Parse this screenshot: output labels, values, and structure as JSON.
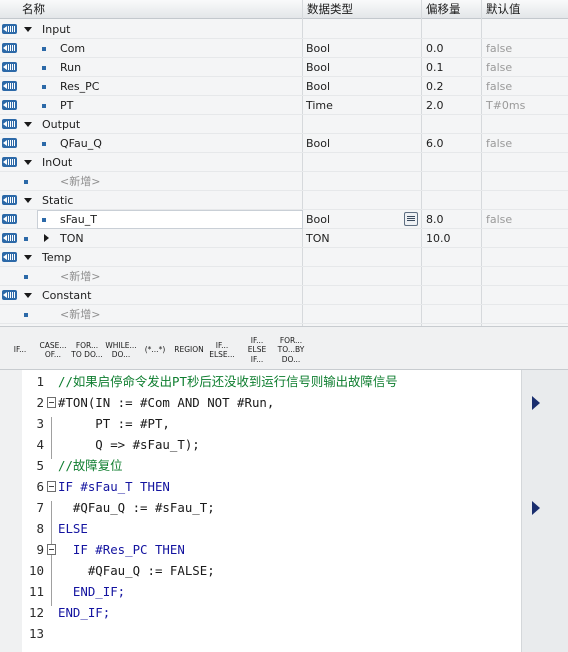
{
  "header": {
    "name": "名称",
    "datatype": "数据类型",
    "offset": "偏移量",
    "default": "默认值"
  },
  "rows": [
    {
      "name": "Input",
      "type": "",
      "offset": "",
      "default": ""
    },
    {
      "name": "Com",
      "type": "Bool",
      "offset": "0.0",
      "default": "false"
    },
    {
      "name": "Run",
      "type": "Bool",
      "offset": "0.1",
      "default": "false"
    },
    {
      "name": "Res_PC",
      "type": "Bool",
      "offset": "0.2",
      "default": "false"
    },
    {
      "name": "PT",
      "type": "Time",
      "offset": "2.0",
      "default": "T#0ms"
    },
    {
      "name": "Output",
      "type": "",
      "offset": "",
      "default": ""
    },
    {
      "name": "QFau_Q",
      "type": "Bool",
      "offset": "6.0",
      "default": "false"
    },
    {
      "name": "InOut",
      "type": "",
      "offset": "",
      "default": ""
    },
    {
      "name": "<新增>",
      "type": "",
      "offset": "",
      "default": ""
    },
    {
      "name": "Static",
      "type": "",
      "offset": "",
      "default": ""
    },
    {
      "name": "sFau_T",
      "type": "Bool",
      "offset": "8.0",
      "default": "false"
    },
    {
      "name": "TON",
      "type": "TON",
      "offset": "10.0",
      "default": ""
    },
    {
      "name": "Temp",
      "type": "",
      "offset": "",
      "default": ""
    },
    {
      "name": "<新增>",
      "type": "",
      "offset": "",
      "default": ""
    },
    {
      "name": "Constant",
      "type": "",
      "offset": "",
      "default": ""
    },
    {
      "name": "<新增>",
      "type": "",
      "offset": "",
      "default": ""
    }
  ],
  "toolbar": [
    "IF...",
    "CASE...\nOF...",
    "FOR...\nTO DO...",
    "WHILE...\nDO...",
    "(*...*)",
    "REGION",
    "IF...\nELSE...",
    "IF...\nELSE\nIF...",
    "FOR...\nTO...BY\nDO..."
  ],
  "code_lines": [
    {
      "n": "1",
      "text": "//如果启停命令发出PT秒后还没收到运行信号则输出故障信号"
    },
    {
      "n": "2",
      "text": "#TON(IN := #Com AND NOT #Run,"
    },
    {
      "n": "3",
      "text": "     PT := #PT,"
    },
    {
      "n": "4",
      "text": "     Q => #sFau_T);"
    },
    {
      "n": "5",
      "text": "//故障复位"
    },
    {
      "n": "6",
      "text": "IF #sFau_T THEN"
    },
    {
      "n": "7",
      "text": "  #QFau_Q := #sFau_T;"
    },
    {
      "n": "8",
      "text": "ELSE"
    },
    {
      "n": "9",
      "text": "  IF #Res_PC THEN"
    },
    {
      "n": "10",
      "text": "    #QFau_Q := FALSE;"
    },
    {
      "n": "11",
      "text": "  END_IF;"
    },
    {
      "n": "12",
      "text": "END_IF;"
    },
    {
      "n": "13",
      "text": ""
    }
  ]
}
